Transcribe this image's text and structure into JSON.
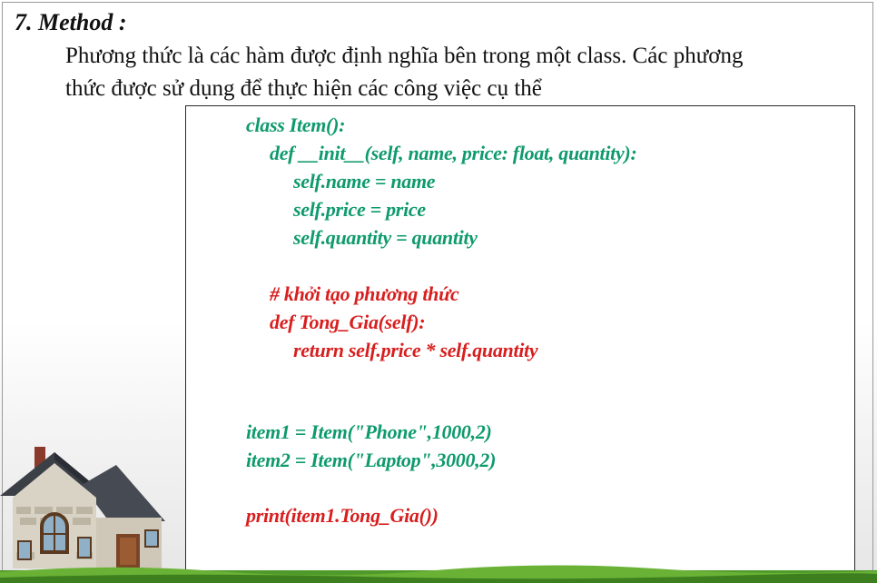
{
  "slide": {
    "heading": "7. Method :",
    "intro_line1": "Phương thức là các hàm được định nghĩa bên trong một class. Các phương",
    "intro_line2": "thức được sử dụng để thực hiện các công việc cụ thể"
  },
  "code": {
    "lines": [
      "class Item():",
      "def __init__(self, name, price: float, quantity):",
      "self.name = name",
      "self.price = price",
      "self.quantity = quantity",
      "# khởi tạo phương thức",
      "def Tong_Gia(self):",
      "return self.price * self.quantity",
      "item1 = Item(\"Phone\",1000,2)",
      "item2 = Item(\"Laptop\",3000,2)",
      "print(item1.Tong_Gia())"
    ]
  },
  "colors": {
    "code_green": "#0f9a6d",
    "code_red": "#d81e1e",
    "grass": "#4f9a2a"
  },
  "icons": {
    "house": "house-illustration",
    "grass": "grass-strip"
  }
}
